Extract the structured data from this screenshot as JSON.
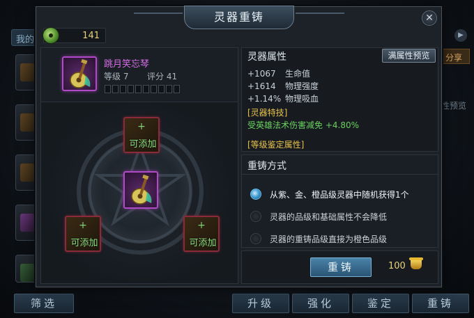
{
  "background": {
    "tab_label": "我的",
    "share_label": "分享",
    "preview_label": "性预览",
    "bottom_buttons": [
      "筛选",
      "升级",
      "强化",
      "鉴定",
      "重铸"
    ]
  },
  "modal": {
    "title": "灵器重铸",
    "close_symbol": "✕",
    "currency": {
      "icon": "jade-coin-icon",
      "value": "141"
    },
    "item": {
      "name": "跳月笑忘琴",
      "level_label": "等级 7",
      "score_label": "评分 41",
      "star_count": 10,
      "icon": "guitar-instrument-icon",
      "rarity_color": "#b04ac8"
    },
    "add_slot_label": "可添加",
    "add_slot_plus": "+",
    "attributes": {
      "title": "灵器属性",
      "full_preview_button": "满属性预览",
      "stats": [
        {
          "value": "+1067",
          "name": "生命值"
        },
        {
          "value": "+1614",
          "name": "物理强度"
        },
        {
          "value": "+1.14%",
          "name": "物理吸血"
        }
      ],
      "special_title": "[灵器特技]",
      "special_effect": "受英雄法术伤害减免 +4.80%",
      "appraisal_title": "[等级鉴定属性]"
    },
    "recast": {
      "title": "重铸方式",
      "options": [
        {
          "text": "从紫、金、橙品级灵器中随机获得1个",
          "selected": true
        },
        {
          "text": "灵器的品级和基础属性不会降低",
          "selected": false
        },
        {
          "text": "灵器的重铸品级直接为橙色品级",
          "selected": false
        }
      ],
      "button_label": "重铸",
      "cost": "100",
      "cost_icon": "gold-ingot-icon"
    }
  }
}
